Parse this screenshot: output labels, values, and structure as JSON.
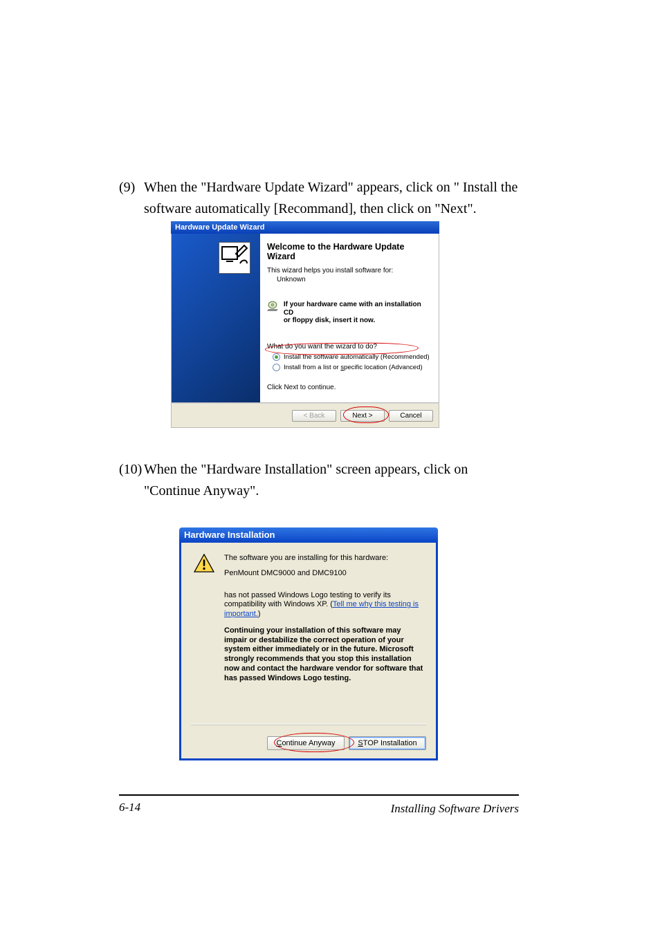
{
  "steps": {
    "s9": {
      "num": "(9)",
      "text": "When the \"Hardware Update Wizard\" appears, click on \" Install the software automatically [Recommand], then click on \"Next\"."
    },
    "s10": {
      "num": "(10)",
      "text": "When the \"Hardware Installation\" screen appears, click on \"Continue Anyway\"."
    }
  },
  "dlg1": {
    "title": "Hardware Update Wizard",
    "heading1": "Welcome to the Hardware Update",
    "heading2": "Wizard",
    "helps": "This wizard helps you install software for:",
    "device": "Unknown",
    "cd_l1": "If your hardware came with an installation CD",
    "cd_l2": "or floppy disk, insert it now.",
    "question": "What do you want the wizard to do?",
    "opt1": "Install the software automatically (Recommended)",
    "opt2_pre": "Install from a list or ",
    "opt2_s": "s",
    "opt2_post": "pecific location (Advanced)",
    "continue": "Click Next to continue.",
    "back": "< Back",
    "next": "Next >",
    "cancel": "Cancel"
  },
  "dlg2": {
    "title": "Hardware Installation",
    "line1": "The software you are installing for this hardware:",
    "device": "PenMount DMC9000 and DMC9100",
    "line3a": "has not passed Windows Logo testing to verify its compatibility with Windows XP. (",
    "link": "Tell me why this testing is important.",
    "line3b": ")",
    "boldmsg": "Continuing your installation of this software may impair or destabilize the correct operation of your system either immediately or in the future. Microsoft strongly recommends that you stop this installation now and contact the hardware vendor for software that has passed Windows Logo testing.",
    "btn_cont_pre": "C",
    "btn_cont_post": "ontinue Anyway",
    "btn_stop_pre": "S",
    "btn_stop_post": "TOP Installation"
  },
  "footer": {
    "pagenum": "6-14",
    "label": "Installing Software Drivers"
  }
}
